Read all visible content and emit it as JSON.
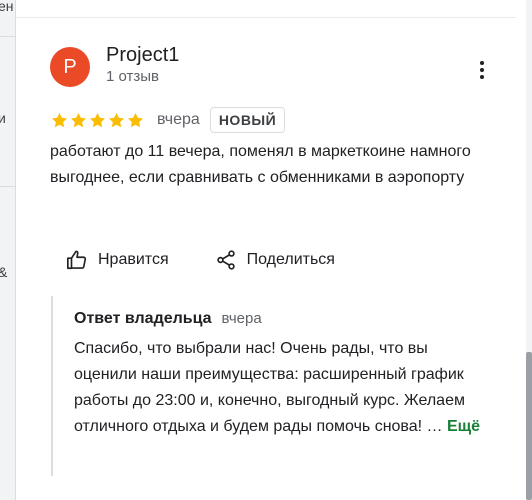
{
  "left_panel": {
    "fragments": [
      "ен",
      "и",
      "&"
    ]
  },
  "review": {
    "avatar_letter": "P",
    "avatar_color": "#ea4a26",
    "author": "Project1",
    "review_count": "1 отзыв",
    "rating": 5,
    "rating_max": 5,
    "star_color": "#fbbc04",
    "date": "вчера",
    "badge": "НОВЫЙ",
    "text": "работают до 11 вечера, поменял в маркеткоине намного выгоднее, если сравнивать с обменниками в аэропорту",
    "more_icon": "more-vert-icon"
  },
  "actions": {
    "like_label": "Нравится",
    "like_icon": "thumb-up-icon",
    "share_label": "Поделиться",
    "share_icon": "share-icon"
  },
  "owner_reply": {
    "title": "Ответ владельца",
    "date": "вчера",
    "text": "Спасибо, что выбрали нас! Очень рады, что вы оценили наши преимущества: расширенный график работы до 23:00 и, конечно, выгодный курс. Желаем отличного отдыха и будем рады помочь снова! …",
    "more_label": "Ещё",
    "more_color": "#188038"
  }
}
